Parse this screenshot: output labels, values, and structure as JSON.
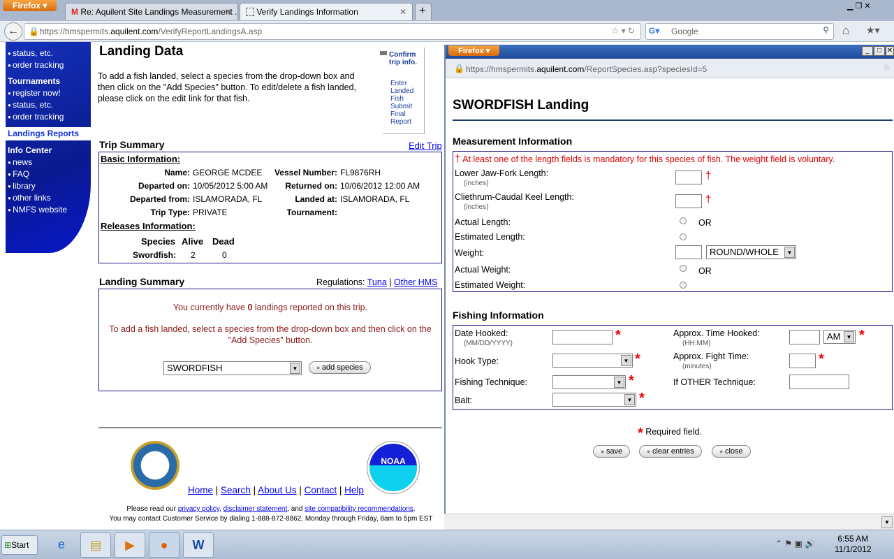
{
  "browser": {
    "menu_label": "Firefox",
    "tabs": [
      {
        "title": "Re: Aquilent Site Landings Measurement ...",
        "icon": "gmail-icon"
      },
      {
        "title": "Verify Landings Information",
        "icon": "page-icon"
      }
    ],
    "url_prefix": "https://hmspermits.",
    "url_domain": "aquilent.com",
    "url_path": "/VerifyReportLandingsA.asp",
    "search_placeholder": "Google"
  },
  "sidebar": {
    "top_partial": "status, etc.",
    "top_items": [
      "status, etc.",
      "order tracking"
    ],
    "tournaments_heading": "Tournaments",
    "tournament_items": [
      "register now!",
      "status, etc.",
      "order tracking"
    ],
    "landings_reports": "Landings Reports",
    "info_heading": "Info Center",
    "info_items": [
      "news",
      "FAQ",
      "library",
      "other links",
      "NMFS website"
    ]
  },
  "main": {
    "title": "Landing Data",
    "intro": "To add a fish landed, select a species from the drop-down box and then click on the \"Add Species\" button. To edit/delete a fish landed, please click on the edit link for that fish.",
    "steps": [
      "Confirm trip info.",
      "Enter Landed Fish",
      "Submit Final Report"
    ],
    "trip_summary": {
      "heading": "Trip Summary",
      "edit_link": "Edit Trip",
      "basic_heading": "Basic Information",
      "fields_left": [
        {
          "label": "Name:",
          "value": "GEORGE MCDEE"
        },
        {
          "label": "Departed on:",
          "value": "10/05/2012 5:00 AM"
        },
        {
          "label": "Departed from:",
          "value": "ISLAMORADA, FL"
        },
        {
          "label": "Trip Type:",
          "value": "PRIVATE"
        }
      ],
      "fields_right": [
        {
          "label": "Vessel Number:",
          "value": "FL9876RH"
        },
        {
          "label": "Returned on:",
          "value": "10/06/2012 12:00 AM"
        },
        {
          "label": "Landed at:",
          "value": "ISLAMORADA, FL"
        },
        {
          "label": "Tournament:",
          "value": ""
        }
      ],
      "releases_heading": "Releases Information",
      "releases_cols": [
        "Species",
        "Alive",
        "Dead"
      ],
      "releases_row": {
        "species": "Swordfish:",
        "alive": "2",
        "dead": "0"
      }
    },
    "landing_summary": {
      "heading": "Landing Summary",
      "regulations_label": "Regulations:",
      "reg_links": [
        "Tuna",
        "Other HMS"
      ],
      "count_pre": "You currently have ",
      "count": "0",
      "count_post": " landings reported on this trip.",
      "instructions": "To add a fish landed, select a species from the drop-down box and then click on the \"Add Species\" button.",
      "species_selected": "SWORDFISH",
      "add_button": "add species"
    },
    "footer": {
      "links": [
        "Home",
        "Search",
        "About Us",
        "Contact",
        "Help"
      ],
      "please_read": "Please read our ",
      "privacy": "privacy policy",
      "disclaimer": "disclaimer statement",
      "and": ", and ",
      "compat": "site compatibility recommendations",
      "contact_text": "You may contact Customer Service by dialing 1-888-872-8862, Monday through Friday, 8am to 5pm EST",
      "logo_left": "DEPARTMENT OF COMMERCE UNITED STATES OF AMERICA",
      "logo_right": "NOAA"
    }
  },
  "popup": {
    "menu_label": "Firefox",
    "url_prefix": "https://hmspermits.",
    "url_domain": "aquilent.com",
    "url_path": "/ReportSpecies.asp?speciesId=5",
    "title": "SWORDFISH Landing",
    "measurement": {
      "heading": "Measurement Information",
      "note": "At least one of the length fields is mandatory for this species of fish. The weight field is voluntary.",
      "lower_jaw": "Lower Jaw-Fork Length:",
      "cleithrum": "Cliethrum-Caudal Keel Length:",
      "inches": "(inches)",
      "actual_length": "Actual Length:",
      "estimated_length": "Estimated Length:",
      "or": "OR",
      "weight": "Weight:",
      "weight_type": "ROUND/WHOLE",
      "actual_weight": "Actual Weight:",
      "estimated_weight": "Estimated Weight:"
    },
    "fishing": {
      "heading": "Fishing Information",
      "date_hooked": "Date Hooked:",
      "date_fmt": "(MM/DD/YYYY)",
      "time_hooked": "Approx. Time Hooked:",
      "time_fmt": "(HH:MM)",
      "ampm": "AM",
      "hook_type": "Hook Type:",
      "fight_time": "Approx. Fight Time:",
      "minutes": "(minutes)",
      "technique": "Fishing Technique:",
      "other_technique": "If OTHER Technique:",
      "bait": "Bait:"
    },
    "required_note": "Required field.",
    "buttons": {
      "save": "save",
      "clear": "clear entries",
      "close": "close"
    }
  },
  "taskbar": {
    "start": "Start",
    "time": "6:55 AM",
    "date": "11/1/2012"
  }
}
